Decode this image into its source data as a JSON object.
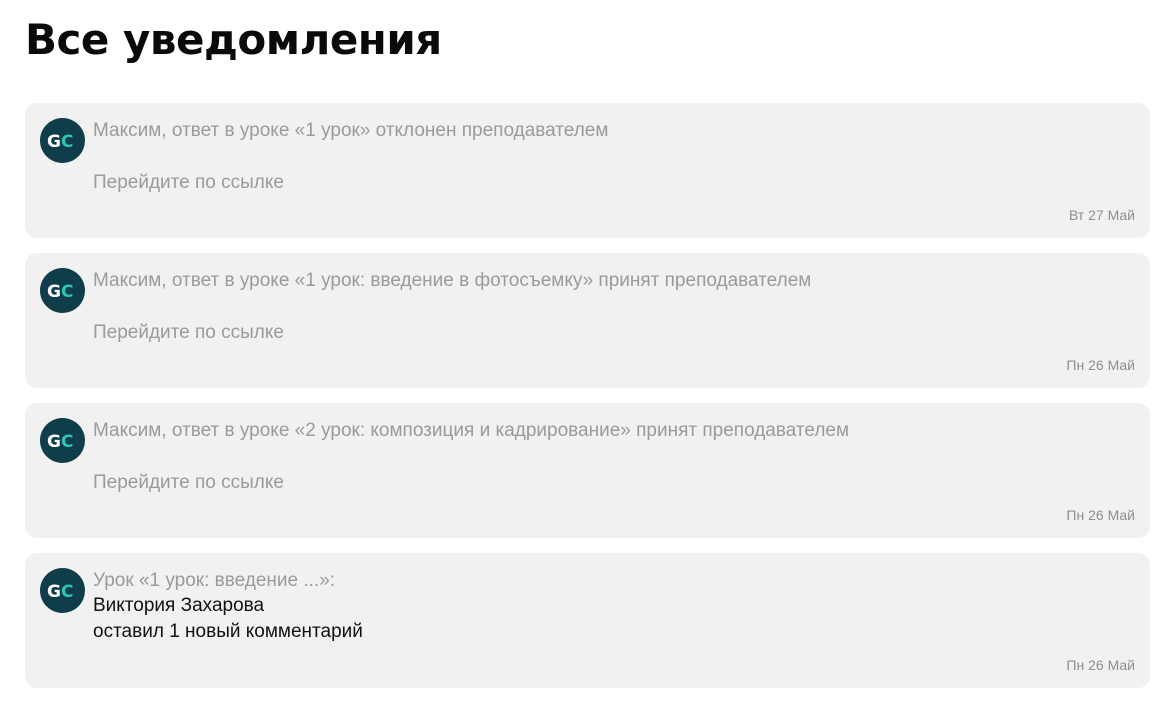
{
  "page": {
    "title": "Все уведомления"
  },
  "colors": {
    "avatar_bg": "#0f3d4a",
    "avatar_accent": "#2ec4b6",
    "card_bg": "#f1f1f1",
    "muted_text": "#9a9a9a"
  },
  "notifications": [
    {
      "avatar_icon": "gc-logo-icon",
      "title": "Максим, ответ в уроке «1 урок» отклонен преподавателем",
      "link_text": "Перейдите по ссылке",
      "date": "Вт 27 Май"
    },
    {
      "avatar_icon": "gc-logo-icon",
      "title": "Максим, ответ в уроке «1 урок: введение в фотосъемку» принят преподавателем",
      "link_text": "Перейдите по ссылке",
      "date": "Пн 26 Май"
    },
    {
      "avatar_icon": "gc-logo-icon",
      "title": "Максим, ответ в уроке «2 урок: композиция и кадрирование» принят преподавателем",
      "link_text": "Перейдите по ссылке",
      "date": "Пн 26 Май"
    },
    {
      "avatar_icon": "gc-logo-icon",
      "title": "Урок «1 урок: введение ...»:",
      "author": "Виктория Захарова",
      "comment_text": "оставил 1 новый комментарий",
      "date": "Пн 26 Май"
    }
  ]
}
